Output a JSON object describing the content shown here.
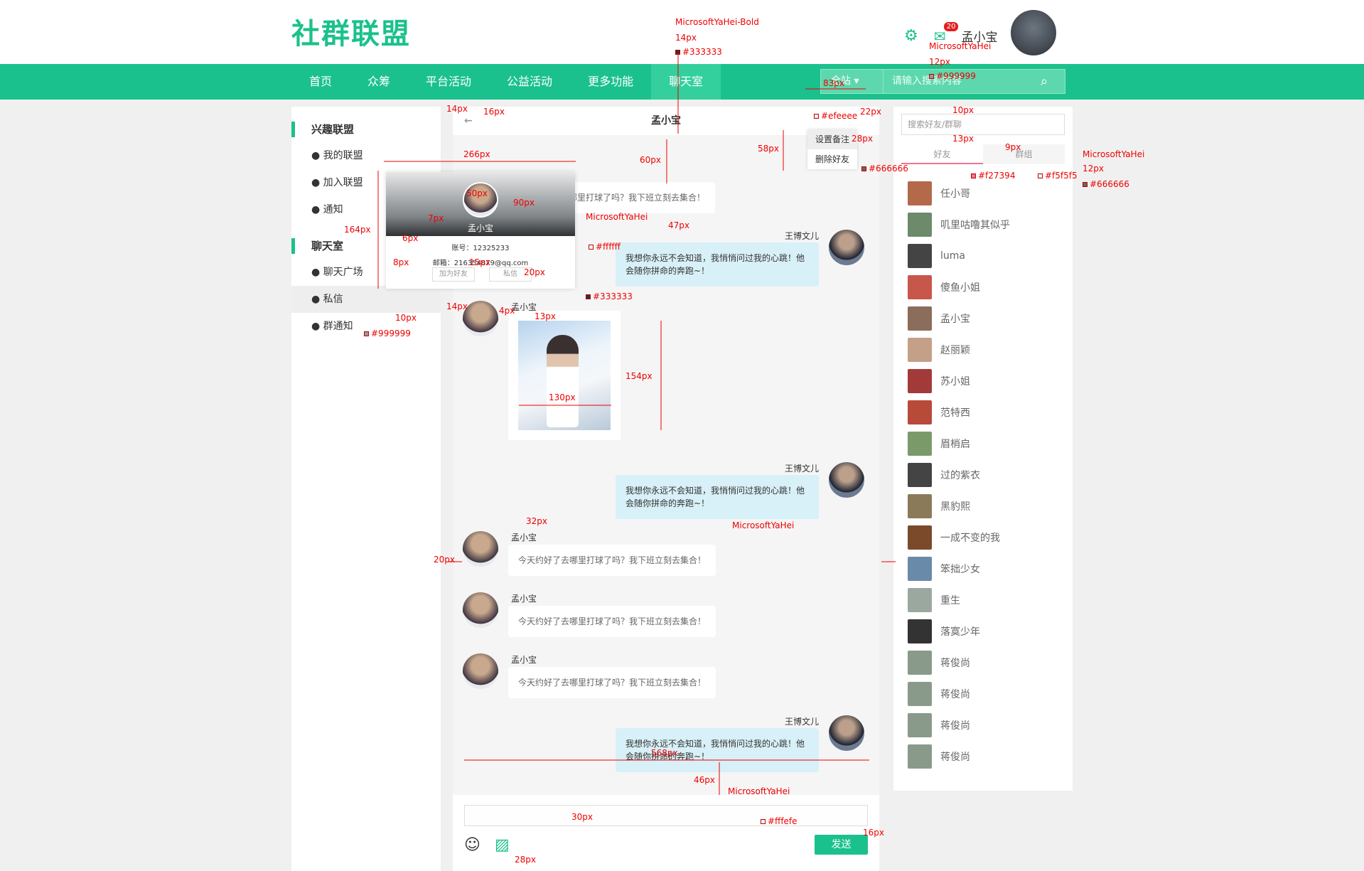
{
  "header": {
    "logo": "社群联盟",
    "username": "孟小宝",
    "mail_count": "20"
  },
  "nav": {
    "items": [
      "首页",
      "众筹",
      "平台活动",
      "公益活动",
      "更多功能",
      "聊天室"
    ]
  },
  "search": {
    "scope": "全站",
    "placeholder": "请输入搜索内容"
  },
  "sidebar": {
    "sec1": "兴趣联盟",
    "items1": [
      "我的联盟",
      "加入联盟",
      "通知"
    ],
    "sec2": "聊天室",
    "items2": [
      "聊天广场",
      "私信",
      "群通知"
    ]
  },
  "chat": {
    "title": "孟小宝",
    "back": "←",
    "menu": [
      "设置备注",
      "删除好友"
    ],
    "msg_text_left": "今天约好了去哪里打球了吗？我下班立刻去集合！",
    "msg_text_right": "我想你永远不会知道，我悄悄问过我的心跳！他会随你拼命的奔跑~！",
    "name_left": "孟小宝",
    "name_right": "王博文儿",
    "send": "发送"
  },
  "profile_card": {
    "name": "孟小宝",
    "account": "账号：12325233",
    "email": "邮箱：216354879@qq.com",
    "btn_add": "加为好友",
    "btn_msg": "私信"
  },
  "friends": {
    "search_placeholder": "搜索好友/群聊",
    "tab_friends": "好友",
    "tab_groups": "群组",
    "list": [
      "任小哥",
      "叽里咕噜其似乎",
      "luma",
      "傻鱼小姐",
      "孟小宝",
      "赵丽颖",
      "苏小姐",
      "范特西",
      "眉梢启",
      "过的紫衣",
      "黑豹熙",
      "一成不变的我",
      "笨拙少女",
      "重生",
      "落寞少年",
      "蒋俊尚",
      "蒋俊尚",
      "蒋俊尚",
      "蒋俊尚"
    ]
  },
  "annotations": [
    "MicrosoftYaHei-Bold",
    "14px",
    "#333333",
    "MicrosoftYaHei",
    "12px",
    "#999999",
    "83px",
    "10px",
    "12px",
    "#efeeee",
    "22px",
    "28px",
    "58px",
    "#666666",
    "13px",
    "9px",
    "MicrosoftYaHei",
    "12px",
    "#f27394",
    "#f5f5f5",
    "#666666",
    "14px",
    "16px",
    "60px",
    "266px",
    "50px",
    "90px",
    "7px",
    "MicrosoftYaHei",
    "#ffffff",
    "47px",
    "164px",
    "6px",
    "8px",
    "15px",
    "20px",
    "10px",
    "#333333",
    "14px",
    "4px",
    "13px",
    "154px",
    "130px",
    "MicrosoftYaHei",
    "#999999",
    "32px",
    "20px",
    "568px",
    "46px",
    "30px",
    "#fffefe",
    "16px",
    "28px",
    "MicrosoftYaHei"
  ]
}
